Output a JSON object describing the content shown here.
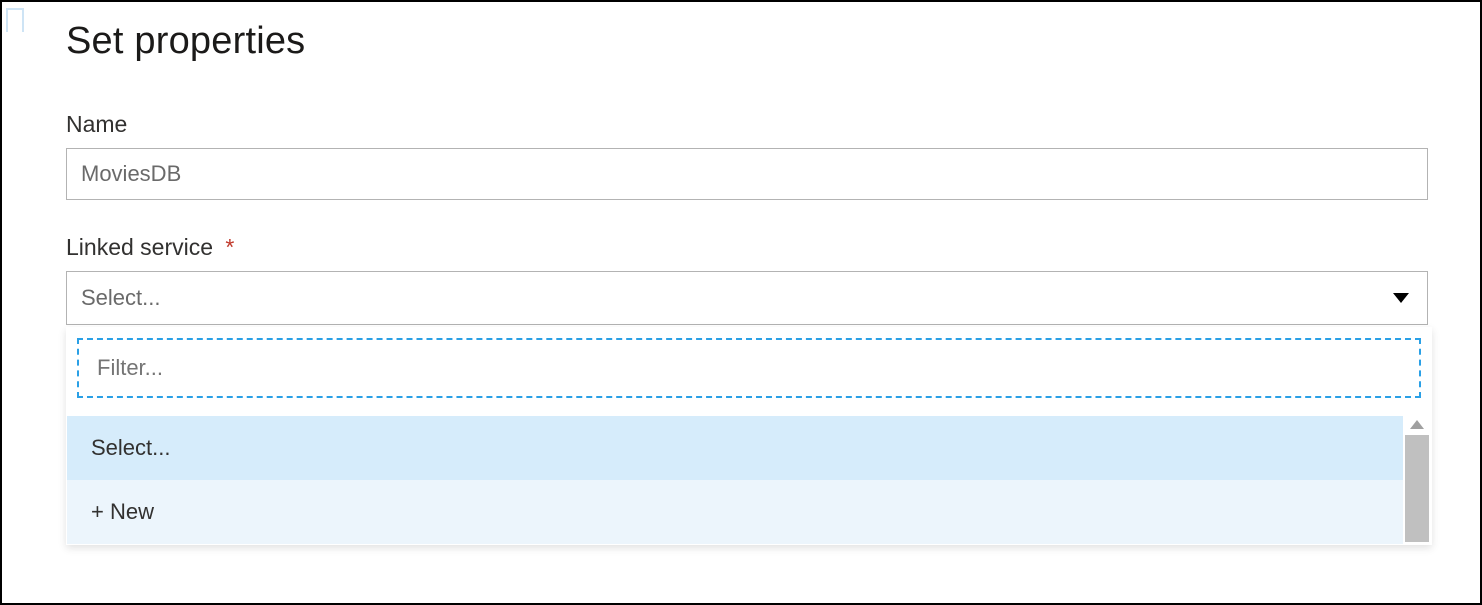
{
  "header": {
    "title": "Set properties"
  },
  "fields": {
    "name": {
      "label": "Name",
      "value": "MoviesDB"
    },
    "linked_service": {
      "label": "Linked service",
      "required_mark": "*",
      "placeholder": "Select...",
      "filter_placeholder": "Filter...",
      "options": {
        "select": "Select...",
        "new": "+ New"
      }
    }
  }
}
